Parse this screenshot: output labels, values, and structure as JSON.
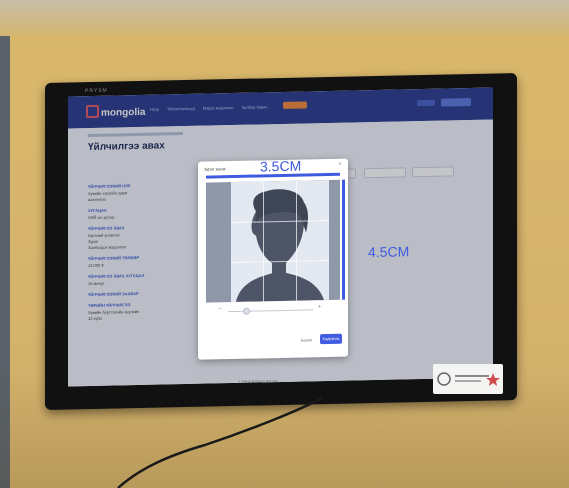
{
  "monitor": {
    "brand": "PRYSM"
  },
  "app": {
    "logo": "mongolia",
    "nav": [
      "Нүүр",
      "Үйлчилгээнүүд",
      "Мэдээ мэдээлэл",
      "Холбоо барих"
    ],
    "page_title": "Үйлчилгээ авах"
  },
  "sidebar": [
    {
      "heading": "ҮЙЛЧИЛГЭЭНИЙ НЭР",
      "lines": [
        "Хувийн хэргийн зураг",
        "шинэчлэх"
      ]
    },
    {
      "heading": "ХУГАЦАА",
      "lines": [
        "ХИЙ ын дотор"
      ]
    },
    {
      "heading": "ҮЙЛЧИЛГЭЭ АВАХ",
      "lines": [
        "Иргэний үнэмлэх",
        "Зураг",
        "Холбогдох мэдээлэл"
      ]
    },
    {
      "heading": "ҮЙЛЧИЛГЭЭНИЙ ТӨЛБӨР",
      "lines": [
        "12,000 ₮"
      ]
    },
    {
      "heading": "ҮЙЛЧИЛГЭЭ АВАХ ХУГАЦАА",
      "lines": [
        "15 минут"
      ]
    },
    {
      "heading": "ҮЙЛЧИЛГЭЭНИЙ ЗААВАР",
      "lines": []
    },
    {
      "heading": "ТӨРИЙН ҮЙЛЧИЛГЭЭ",
      "lines": [
        "Хувийн бүртгэлийн хуулийн",
        "12 зүйл"
      ]
    }
  ],
  "modal": {
    "title": "Зураг засах",
    "close": "×",
    "width_label": "3.5CM",
    "height_label": "4.5CM",
    "cancel": "Болих",
    "save": "Хадгалах"
  },
  "footer": {
    "text": "+ Нэгж бүрдэл дүгнэх"
  },
  "sticker": {
    "text": ""
  },
  "colors": {
    "accent": "#3f5be0",
    "header": "#2c3e8f",
    "wall": "#d7b56c"
  }
}
